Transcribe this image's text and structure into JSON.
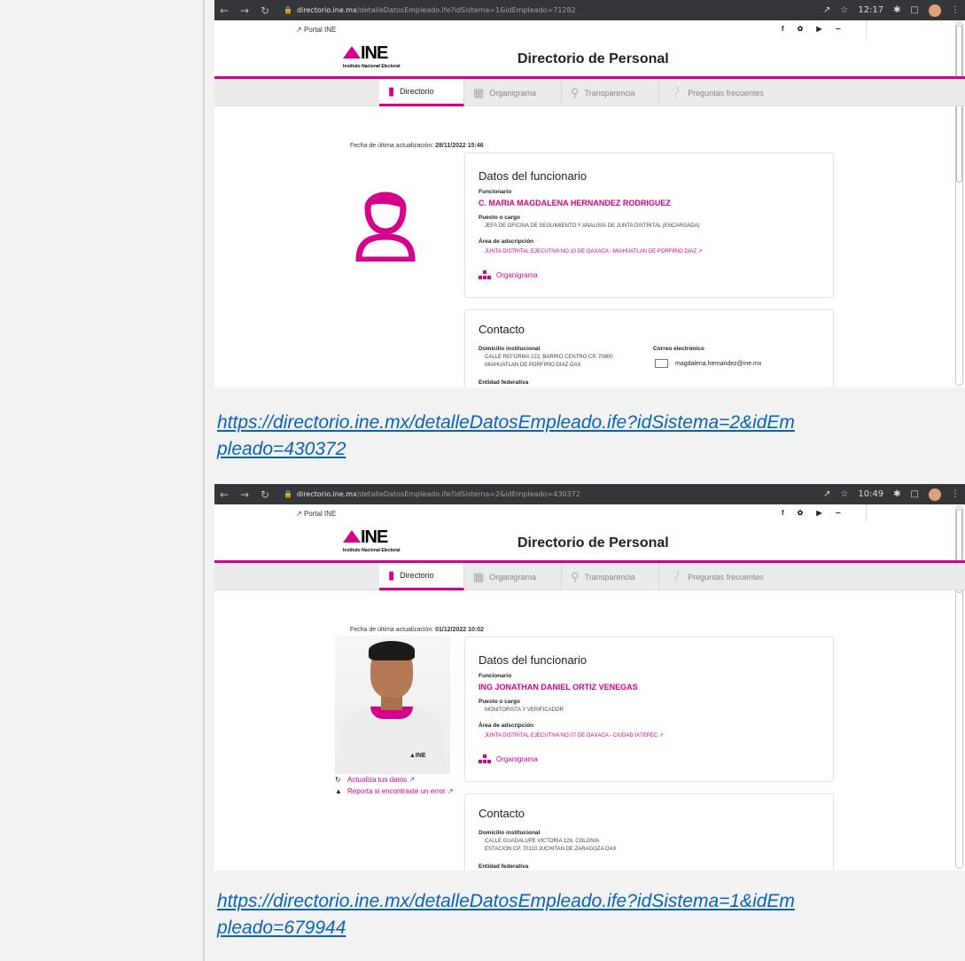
{
  "colors": {
    "accent": "#d6008c",
    "link": "#0563c1",
    "chrome": "#35363a"
  },
  "screenshots": [
    {
      "browser": {
        "host": "directorio.ine.mx",
        "path": "/detalleDatosEmpleado.ife?idSistema=1&idEmpleado=71282",
        "time": "12:17"
      },
      "portal": "Portal INE",
      "social": [
        "f",
        "y",
        "o",
        "r"
      ],
      "logo": {
        "mark": "INE",
        "sub": "Instituto Nacional Electoral"
      },
      "header_title": "Directorio de Personal",
      "tabs": [
        "Directorio",
        "Organigrama",
        "Transparencia",
        "Preguntas frecuentes"
      ],
      "fecha_label": "Fecha de última actualización:",
      "fecha_value": "28/11/2022 15:46",
      "datos": {
        "title": "Datos del funcionario",
        "funcionario_label": "Funcionario",
        "funcionario": "C. MARIA MAGDALENA HERNANDEZ RODRIGUEZ",
        "puesto_label": "Puesto o cargo",
        "puesto": "JEFA DE OFICINA DE SEGUIMIENTO Y ANALISIS DE JUNTA DISTRITAL (ENCARGADA)",
        "area_label": "Área de adscripción",
        "area": "JUNTA DISTRITAL EJECUTIVA NO.10 DE OAXACA - MIAHUATLAN DE PORFIRIO DIAZ",
        "organigrama": "Organigrama"
      },
      "contacto": {
        "title": "Contacto",
        "domicilio_label": "Domicilio institucional",
        "domicilio1": "CALLE REFORMA 222, BARRIO CENTRO CP. 70800",
        "domicilio2": "MIAHUATLAN DE PORFIRIO DIAZ OAX",
        "correo_label": "Correo electrónico",
        "correo": "magdalena.hernandez@ine.mx",
        "entidad_label": "Entidad federativa"
      }
    },
    {
      "browser": {
        "host": "directorio.ine.mx",
        "path": "/detalleDatosEmpleado.ife?idSistema=2&idEmpleado=430372",
        "time": "10:49"
      },
      "portal": "Portal INE",
      "social": [
        "f",
        "y",
        "o",
        "r"
      ],
      "logo": {
        "mark": "INE",
        "sub": "Instituto Nacional Electoral"
      },
      "header_title": "Directorio de Personal",
      "tabs": [
        "Directorio",
        "Organigrama",
        "Transparencia",
        "Preguntas frecuentes"
      ],
      "fecha_label": "Fecha de última actualización:",
      "fecha_value": "01/12/2022 10:02",
      "datos": {
        "title": "Datos del funcionario",
        "funcionario_label": "Funcionario",
        "funcionario": "ING JONATHAN DANIEL ORTIZ VENEGAS",
        "puesto_label": "Puesto o cargo",
        "puesto": "MONITORISTA Y VERIFICADOR",
        "area_label": "Área de adscripción",
        "area": "JUNTA DISTRITAL EJECUTIVA NO.07 DE OAXACA - CIUDAD IXTEPEC",
        "organigrama": "Organigrama"
      },
      "side": {
        "actualiza": "Actualiza tus datos",
        "reporta": "Reporta si encontraste un error"
      },
      "contacto": {
        "title": "Contacto",
        "domicilio_label": "Domicilio institucional",
        "domicilio1": "CALLE GUADALUPE VICTORIA 126, COLONIA",
        "domicilio2": "ESTACION CP. 70110 JUCHITAN DE ZARAGOZA OAX",
        "entidad_label": "Entidad federativa"
      }
    }
  ],
  "links": [
    "https://directorio.ine.mx/detalleDatosEmpleado.ife?idSistema=2&idEmpleado=430372",
    "https://directorio.ine.mx/detalleDatosEmpleado.ife?idSistema=1&idEmpleado=679944"
  ],
  "link_lines": [
    [
      "https://directorio.ine.mx/detalleDatosEmpleado.ife?idSistema=2&idEm",
      "pleado=430372"
    ],
    [
      "https://directorio.ine.mx/detalleDatosEmpleado.ife?idSistema=1&idEm",
      "pleado=679944"
    ]
  ]
}
